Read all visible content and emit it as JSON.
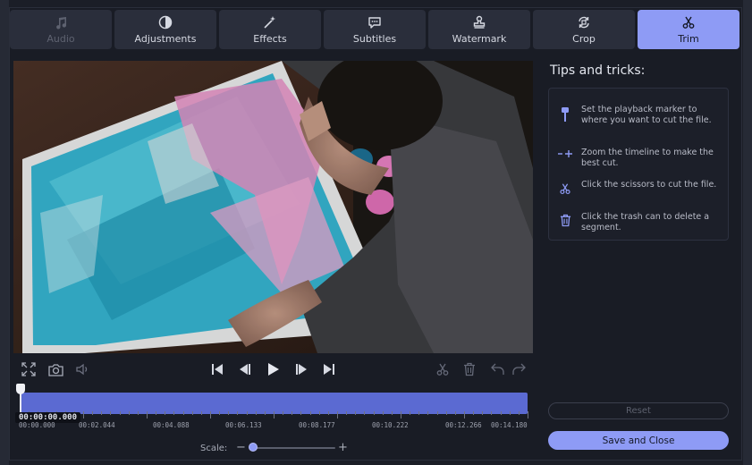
{
  "tabs": [
    {
      "label": "Audio",
      "icon": "music-note-icon",
      "state": "disabled"
    },
    {
      "label": "Adjustments",
      "icon": "contrast-icon",
      "state": "normal"
    },
    {
      "label": "Effects",
      "icon": "magic-wand-icon",
      "state": "normal"
    },
    {
      "label": "Subtitles",
      "icon": "speech-bubble-icon",
      "state": "normal"
    },
    {
      "label": "Watermark",
      "icon": "stamp-icon",
      "state": "normal"
    },
    {
      "label": "Crop",
      "icon": "crop-rotate-icon",
      "state": "normal"
    },
    {
      "label": "Trim",
      "icon": "scissors-icon",
      "state": "active"
    }
  ],
  "player": {
    "controls_left": [
      "fullscreen-icon",
      "snapshot-icon",
      "volume-icon"
    ],
    "controls_center": [
      "skip-start-icon",
      "previous-frame-icon",
      "play-icon",
      "next-frame-icon",
      "skip-end-icon"
    ],
    "controls_right": [
      "scissors-icon",
      "trash-icon",
      "undo-icon",
      "redo-icon"
    ]
  },
  "timeline": {
    "current_time": "00:00:00.000",
    "labels": [
      "00:00.000",
      "00:02.044",
      "00:04.088",
      "00:06.133",
      "00:08.177",
      "00:10.222",
      "00:12.266",
      "00:14.180"
    ],
    "scale_label": "Scale:",
    "scale_minus": "−",
    "scale_plus": "+",
    "scale_level": 0.0
  },
  "tips": {
    "title": "Tips and tricks:",
    "items": [
      {
        "icon": "marker-icon",
        "text": "Set the playback marker to where you want to cut the file."
      },
      {
        "icon": "zoom-timeline-icon",
        "text": "Zoom the timeline to make the best cut."
      },
      {
        "icon": "scissors-icon",
        "text": "Click the scissors to cut the file."
      },
      {
        "icon": "trash-icon",
        "text": "Click the trash can to delete a segment."
      }
    ]
  },
  "buttons": {
    "reset": "Reset",
    "save_close": "Save and Close"
  },
  "colors": {
    "accent": "#8e9bf5",
    "timeline_fill": "#5b6ad2",
    "background": "#191c25"
  }
}
